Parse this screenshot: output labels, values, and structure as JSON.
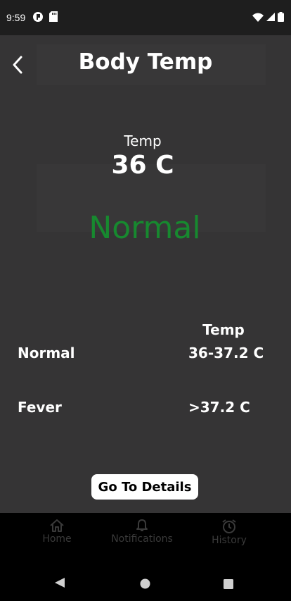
{
  "status_bar": {
    "time": "9:59"
  },
  "header": {
    "title": "Body Temp"
  },
  "reading": {
    "label": "Temp",
    "value": "36 C",
    "status": "Normal",
    "status_color": "#17892f"
  },
  "reference_table": {
    "header": "Temp",
    "rows": [
      {
        "label": "Normal",
        "value": "36-37.2 C"
      },
      {
        "label": "Fever",
        "value": ">37.2 C"
      }
    ]
  },
  "actions": {
    "details_label": "Go To Details"
  },
  "tab_bar": {
    "items": [
      {
        "label": "Home",
        "icon": "home-icon"
      },
      {
        "label": "Notifications",
        "icon": "bell-icon"
      },
      {
        "label": "History",
        "icon": "alarm-clock-icon"
      }
    ]
  },
  "colors": {
    "background": "#353435",
    "accent": "#17892f",
    "tab_inactive": "#3a3a3a"
  }
}
